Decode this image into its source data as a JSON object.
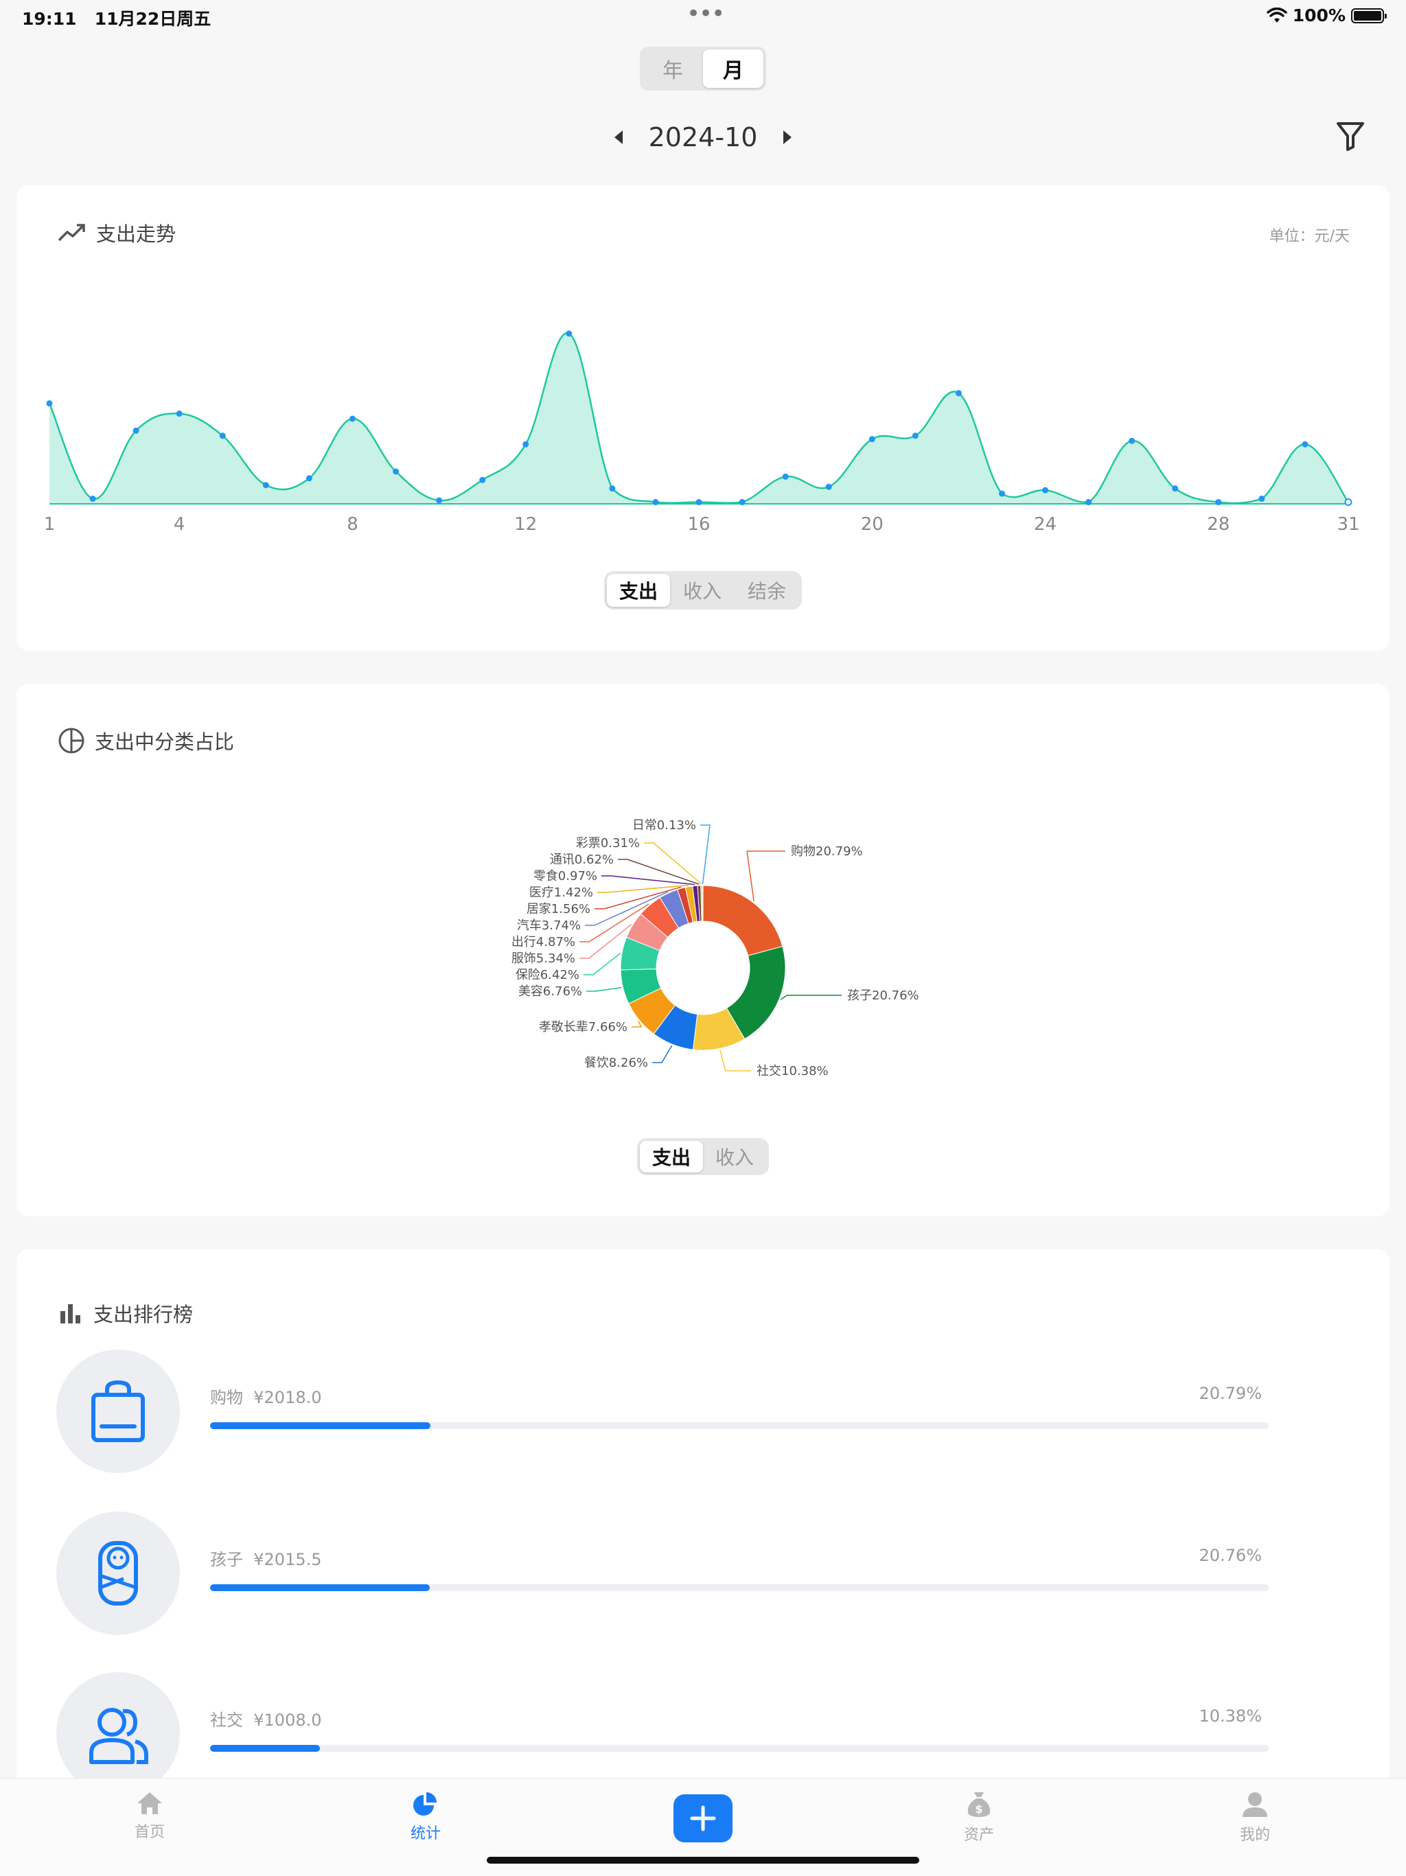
{
  "status_bar": {
    "time": "19:11",
    "date": "11月22日周五",
    "battery": "100%"
  },
  "period_toggle": {
    "options": [
      "年",
      "月"
    ],
    "selected": "月"
  },
  "period": {
    "label": "2024-10"
  },
  "trend_card": {
    "title": "支出走势",
    "unit": "单位：元/天",
    "tabs": [
      "支出",
      "收入",
      "结余"
    ],
    "selected_tab": "支出"
  },
  "category_card": {
    "title": "支出中分类占比",
    "tabs": [
      "支出",
      "收入"
    ],
    "selected_tab": "支出"
  },
  "ranking_card": {
    "title": "支出排行榜",
    "items": [
      {
        "name": "购物",
        "amount": "¥2018.0",
        "percent": "20.79%",
        "fraction": 0.2079,
        "icon": "shopping-bag-icon"
      },
      {
        "name": "孩子",
        "amount": "¥2015.5",
        "percent": "20.76%",
        "fraction": 0.2076,
        "icon": "baby-icon"
      },
      {
        "name": "社交",
        "amount": "¥1008.0",
        "percent": "10.38%",
        "fraction": 0.1038,
        "icon": "people-icon"
      }
    ]
  },
  "tab_bar": {
    "items": [
      {
        "label": "首页",
        "icon": "home-icon"
      },
      {
        "label": "统计",
        "icon": "pie-chart-icon",
        "active": true
      },
      {
        "label": "资产",
        "icon": "money-bag-icon"
      },
      {
        "label": "我的",
        "icon": "user-icon"
      }
    ]
  },
  "colors": {
    "accent": "#1a7cf5",
    "trend_line": "#1ec8a0",
    "trend_fill": "#c9f2e6",
    "trend_dot": "#2196f3"
  },
  "chart_data": [
    {
      "type": "area",
      "x": [
        1,
        2,
        3,
        4,
        5,
        6,
        7,
        8,
        9,
        10,
        11,
        12,
        13,
        14,
        15,
        16,
        17,
        18,
        19,
        20,
        21,
        22,
        23,
        24,
        25,
        26,
        27,
        28,
        29,
        30,
        31
      ],
      "x_ticks": [
        1,
        4,
        8,
        12,
        16,
        20,
        24,
        28,
        31
      ],
      "series": [
        {
          "values": [
            59,
            3,
            43,
            53,
            40,
            11,
            15,
            50,
            19,
            2,
            14,
            35,
            100,
            9,
            1,
            1,
            1,
            16,
            10,
            38,
            40,
            65,
            6,
            8,
            1,
            37,
            9,
            1,
            3,
            35,
            1
          ]
        }
      ],
      "ylim": [
        0,
        100
      ],
      "grid": false
    },
    {
      "type": "pie",
      "donut": true,
      "labels": [
        "购物",
        "孩子",
        "社交",
        "餐饮",
        "孝敬长辈",
        "美容",
        "保险",
        "服饰",
        "出行",
        "汽车",
        "居家",
        "医疗",
        "零食",
        "通讯",
        "彩票",
        "日常"
      ],
      "values": [
        20.79,
        20.76,
        10.38,
        8.26,
        7.66,
        6.76,
        6.42,
        5.34,
        4.87,
        3.74,
        1.56,
        1.42,
        0.97,
        0.62,
        0.31,
        0.13
      ],
      "display_labels": [
        "购物20.79%",
        "孩子20.76%",
        "社交10.38%",
        "餐饮8.26%",
        "孝敬长辈7.66%",
        "美容6.76%",
        "保险6.42%",
        "服饰5.34%",
        "出行4.87%",
        "汽车3.74%",
        "居家1.56%",
        "医疗1.42%",
        "零食0.97%",
        "通讯0.62%",
        "彩票0.31%",
        "日常0.13%"
      ],
      "colors": [
        "#e55c2a",
        "#0d8a3a",
        "#f7c93e",
        "#1673e6",
        "#f59b13",
        "#1bc28a",
        "#2fcfa0",
        "#f4908c",
        "#f46142",
        "#6e7fd6",
        "#d6432f",
        "#f0b11a",
        "#5a1f8a",
        "#6d4a3e",
        "#f2c31d",
        "#36aaf2"
      ]
    }
  ]
}
